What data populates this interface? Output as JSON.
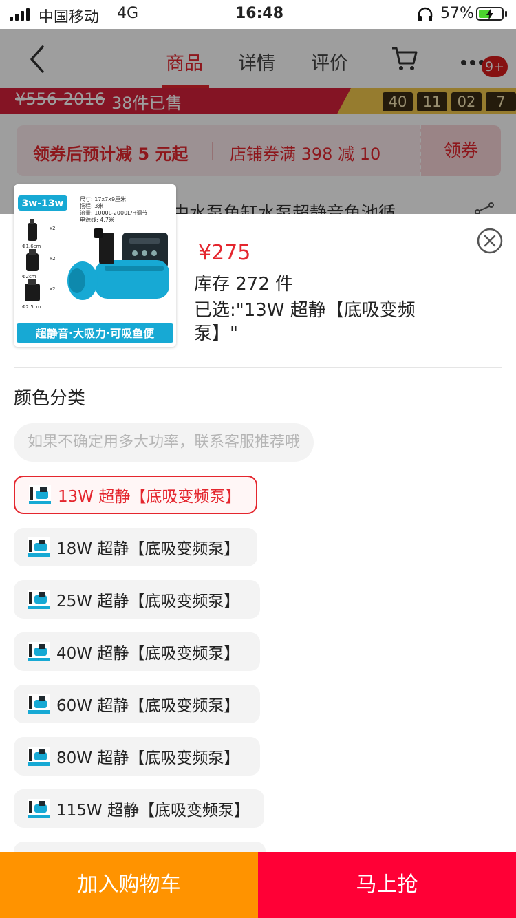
{
  "status_bar": {
    "carrier": "中国移动",
    "network": "4G",
    "time": "16:48",
    "battery": "57%",
    "battery_level": 0.57
  },
  "navbar": {
    "tabs": [
      {
        "label": "商品",
        "active": true
      },
      {
        "label": "详情",
        "active": false
      },
      {
        "label": "评价",
        "active": false
      }
    ],
    "badge": "9+"
  },
  "promo": {
    "old_price": "¥556-2016",
    "sold": "38件已售",
    "timer": [
      "40",
      "11",
      "02",
      "7"
    ]
  },
  "coupon": {
    "left_text": "领券后预计减 5 元起",
    "middle_text": "店铺券满 398 减 10",
    "button": "领券"
  },
  "product_title_partial": "中水泵鱼缸水泵超静音鱼池循",
  "thumbnail": {
    "tag": "3w-13w",
    "specs": [
      "尺寸: 17x7x9厘米",
      "扬程: 3米",
      "流量: 1000L-2000L/H调节",
      "电源线: 4.7米"
    ],
    "sizes": [
      "Φ1.6cm",
      "Φ2cm",
      "Φ2.5cm"
    ],
    "counts": [
      "x2",
      "x2",
      "x2"
    ],
    "banner": "超静音·大吸力·可吸鱼便"
  },
  "sheet": {
    "price": "¥275",
    "stock": "库存 272 件",
    "selected": "已选:\"13W 超静【底吸变频泵】\"",
    "section_title": "颜色分类",
    "hint": "如果不确定用多大功率，联系客服推荐哦",
    "options": [
      {
        "label": "13W 超静【底吸变频泵】",
        "selected": true
      },
      {
        "label": "18W 超静【底吸变频泵】",
        "selected": false
      },
      {
        "label": "25W 超静【底吸变频泵】",
        "selected": false
      },
      {
        "label": "40W 超静【底吸变频泵】",
        "selected": false
      },
      {
        "label": "60W 超静【底吸变频泵】",
        "selected": false
      },
      {
        "label": "80W 超静【底吸变频泵】",
        "selected": false
      },
      {
        "label": "115W 超静【底吸变频泵】",
        "selected": false
      }
    ]
  },
  "bottom": {
    "add_cart": "加入购物车",
    "buy_now": "马上抢"
  },
  "colors": {
    "accent_red": "#e4262e",
    "cart_orange": "#ff9300",
    "buy_red": "#ff0036",
    "pump_blue": "#17a9d4"
  }
}
